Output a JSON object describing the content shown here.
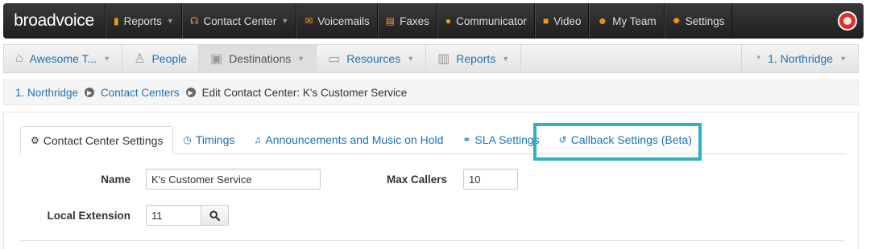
{
  "brand": {
    "name": "broadvoice"
  },
  "topnav": [
    {
      "id": "reports",
      "icon": "bar-chart-icon",
      "label": "Reports",
      "dropdown": true
    },
    {
      "id": "contact-center",
      "icon": "headset-icon",
      "label": "Contact Center",
      "dropdown": true
    },
    {
      "id": "voicemails",
      "icon": "envelope-icon",
      "label": "Voicemails"
    },
    {
      "id": "faxes",
      "icon": "fax-icon",
      "label": "Faxes"
    },
    {
      "id": "communicator",
      "icon": "chat-icon",
      "label": "Communicator"
    },
    {
      "id": "video",
      "icon": "video-camera-icon",
      "label": "Video"
    },
    {
      "id": "my-team",
      "icon": "team-icon",
      "label": "My Team"
    },
    {
      "id": "settings",
      "icon": "gear-icon",
      "label": "Settings"
    }
  ],
  "subnav": {
    "items": [
      {
        "id": "home",
        "icon": "home-icon",
        "label": "Awesome T...",
        "dropdown": true
      },
      {
        "id": "people",
        "icon": "people-icon",
        "label": "People"
      },
      {
        "id": "destinations",
        "icon": "destinations-icon",
        "label": "Destinations",
        "dropdown": true,
        "active": true
      },
      {
        "id": "resources",
        "icon": "resources-icon",
        "label": "Resources",
        "dropdown": true
      },
      {
        "id": "reports",
        "icon": "report-icon",
        "label": "Reports",
        "dropdown": true
      }
    ],
    "location": {
      "icon": "globe-icon",
      "label": "1. Northridge"
    }
  },
  "breadcrumb": {
    "items": [
      "1. Northridge",
      "Contact Centers"
    ],
    "current": "Edit Contact Center: K's Customer Service"
  },
  "tabs": [
    {
      "id": "cc-settings",
      "icon": "cogs-icon",
      "label": "Contact Center Settings",
      "active": true
    },
    {
      "id": "timings",
      "icon": "clock-icon",
      "label": "Timings"
    },
    {
      "id": "announcements",
      "icon": "music-note-icon",
      "label": "Announcements and Music on Hold"
    },
    {
      "id": "sla",
      "icon": "handshake-icon",
      "label": "SLA Settings"
    },
    {
      "id": "callback",
      "icon": "undo-icon",
      "label": "Callback Settings (Beta)",
      "highlighted": true
    }
  ],
  "form": {
    "name_label": "Name",
    "name_value": "K's Customer Service",
    "max_callers_label": "Max Callers",
    "max_callers_value": "10",
    "local_extension_label": "Local Extension",
    "local_extension_value": "11"
  },
  "colors": {
    "accent": "#1a73b5",
    "topnav_icon": "#f39c12",
    "highlight": "#2bb3c3"
  }
}
